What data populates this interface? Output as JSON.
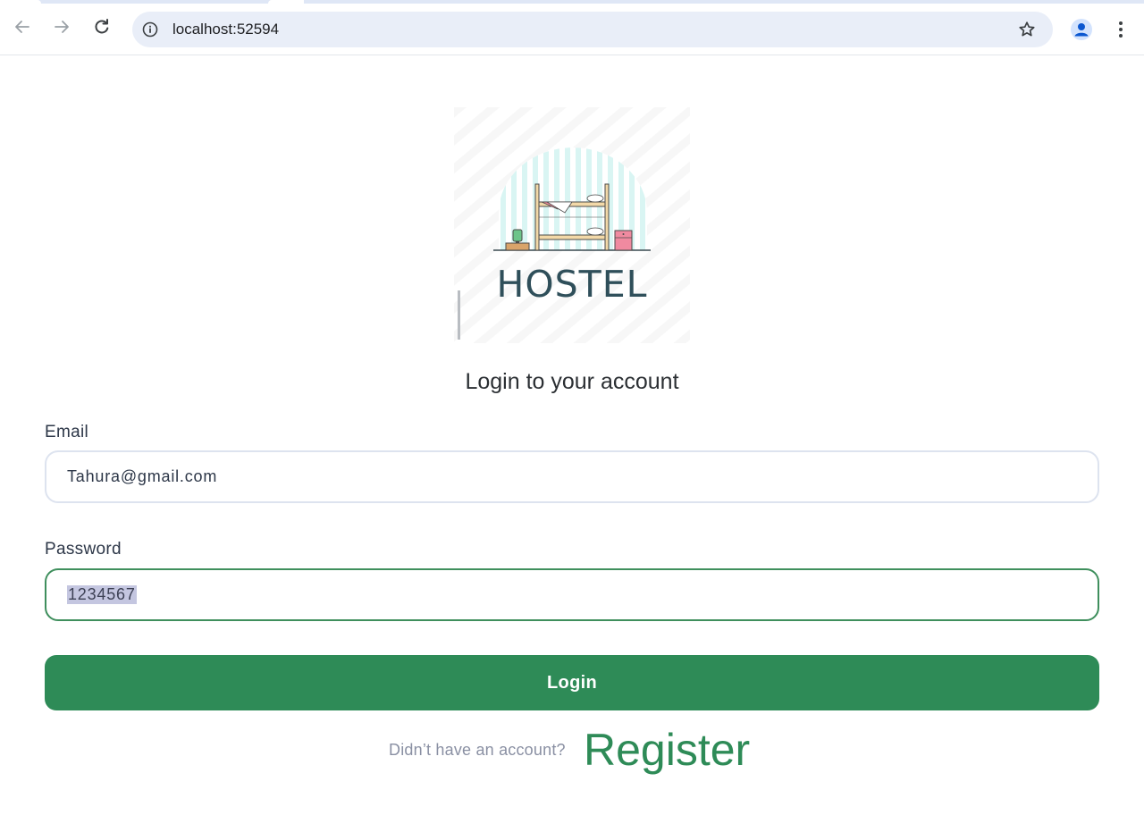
{
  "browser": {
    "url": "localhost:52594",
    "nav": {
      "back_icon": "arrow-left-icon",
      "forward_icon": "arrow-right-icon",
      "reload_icon": "reload-icon"
    },
    "omnibox_icons": [
      "info-icon",
      "star-icon"
    ],
    "toolbar_icons": [
      "profile-icon",
      "kebab-menu-icon"
    ]
  },
  "logo": {
    "text": "HOSTEL",
    "icon": "bunk-bed-illustration",
    "colors": {
      "text": "#2f4f5a",
      "stripes": "#d9f5f3",
      "bed": "#f3d9a8"
    }
  },
  "login": {
    "title": "Login to your account",
    "email_label": "Email",
    "email_value": "Tahura@gmail.com",
    "password_label": "Password",
    "password_value": "1234567",
    "button_label": "Login",
    "register_prompt": "Didn’t have an account?",
    "register_link": "Register"
  },
  "colors": {
    "accent": "#2e8b57",
    "input_border": "#dde3ef",
    "focused_border": "#3f8f5d",
    "muted_text": "#8a90a3"
  }
}
